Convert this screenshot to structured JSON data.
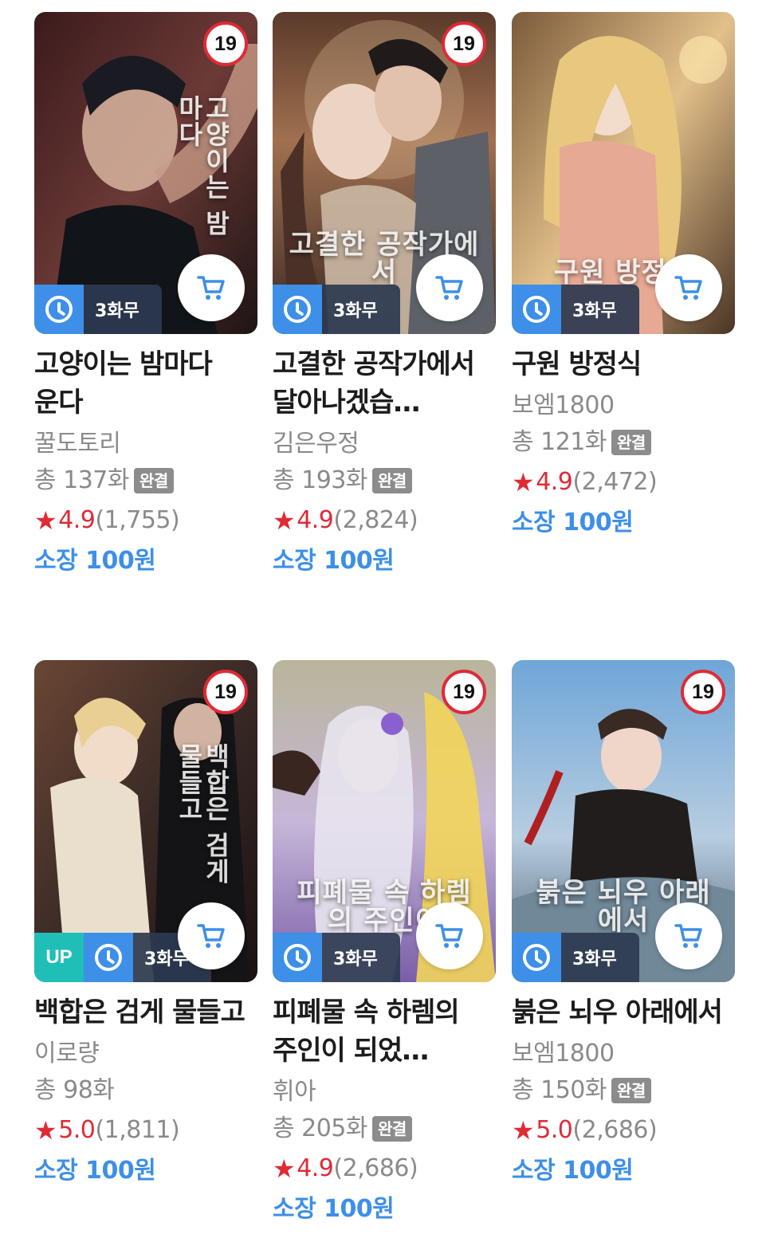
{
  "badge_19": "19",
  "wait_label": "3화무",
  "up_label": "UP",
  "done_label": "완결",
  "rating_star": "★",
  "books": [
    {
      "title": "고양이는 밤마다 운다",
      "cover_text": "고양이는 밤마다",
      "author": "꿀도토리",
      "episodes": "총 137화",
      "completed": true,
      "score": "4.9",
      "count": "(1,755)",
      "price": "소장 100원",
      "up": false
    },
    {
      "title": "고결한 공작가에서 달아나겠습…",
      "cover_text": "고결한 공작가에서",
      "author": "김은우정",
      "episodes": "총 193화",
      "completed": true,
      "score": "4.9",
      "count": "(2,824)",
      "price": "소장 100원",
      "up": false
    },
    {
      "title": "구원 방정식",
      "cover_text": "구원 방정식",
      "author": "보엠1800",
      "episodes": "총 121화",
      "completed": true,
      "score": "4.9",
      "count": "(2,472)",
      "price": "소장 100원",
      "up": false
    },
    {
      "title": "백합은 검게 물들고",
      "cover_text": "백합은 검게 물들고",
      "author": "이로량",
      "episodes": "총 98화",
      "completed": false,
      "score": "5.0",
      "count": "(1,811)",
      "price": "소장 100원",
      "up": true
    },
    {
      "title": "피폐물 속 하렘의 주인이 되었…",
      "cover_text": "피폐물 속 하렘의 주인이",
      "author": "휘아",
      "episodes": "총 205화",
      "completed": true,
      "score": "4.9",
      "count": "(2,686)",
      "price": "소장 100원",
      "up": false
    },
    {
      "title": "붉은 뇌우 아래에서",
      "cover_text": "붉은 뇌우 아래에서",
      "author": "보엠1800",
      "episodes": "총 150화",
      "completed": true,
      "score": "5.0",
      "count": "(2,686)",
      "price": "소장 100원",
      "up": false
    }
  ]
}
